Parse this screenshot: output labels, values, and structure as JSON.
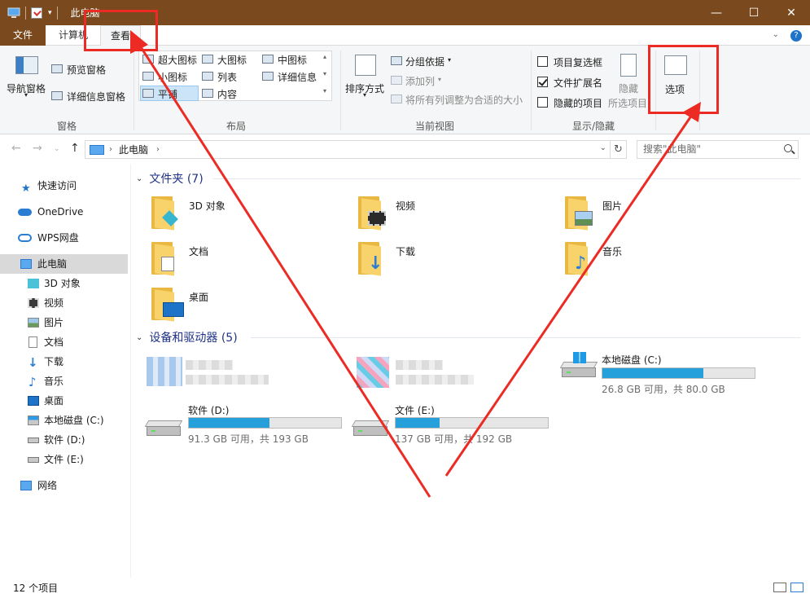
{
  "titlebar": {
    "title": "此电脑",
    "minimize_glyph": "—",
    "maximize_glyph": "☐",
    "close_glyph": "✕"
  },
  "tabs": {
    "file": "文件",
    "computer": "计算机",
    "view": "查看"
  },
  "ribbon": {
    "pane": {
      "nav_pane": "导航窗格",
      "preview_pane": "预览窗格",
      "details_pane": "详细信息窗格",
      "label": "窗格"
    },
    "layout": {
      "xl_icons": "超大图标",
      "large_icons": "大图标",
      "medium_icons": "中图标",
      "small_icons": "小图标",
      "list": "列表",
      "details": "详细信息",
      "tiles": "平铺",
      "content": "内容",
      "label": "布局"
    },
    "current_view": {
      "sort_by": "排序方式",
      "group_by": "分组依据",
      "add_column": "添加列",
      "fit_columns": "将所有列调整为合适的大小",
      "label": "当前视图"
    },
    "show_hide": {
      "item_checkboxes": "项目复选框",
      "file_extensions": "文件扩展名",
      "hidden_items": "隐藏的项目",
      "hide_selected": "隐藏",
      "hide_selected_sub": "所选项目",
      "label": "显示/隐藏",
      "checks": {
        "item_checkboxes": false,
        "file_extensions": true,
        "hidden_items": false
      }
    },
    "options": "选项"
  },
  "address": {
    "path": "此电脑",
    "search_placeholder": "搜索\"此电脑\""
  },
  "sidebar": {
    "items": [
      {
        "label": "快速访问"
      },
      {
        "label": "OneDrive"
      },
      {
        "label": "WPS网盘"
      },
      {
        "label": "此电脑"
      },
      {
        "label": "3D 对象"
      },
      {
        "label": "视频"
      },
      {
        "label": "图片"
      },
      {
        "label": "文档"
      },
      {
        "label": "下载"
      },
      {
        "label": "音乐"
      },
      {
        "label": "桌面"
      },
      {
        "label": "本地磁盘 (C:)"
      },
      {
        "label": "软件 (D:)"
      },
      {
        "label": "文件 (E:)"
      },
      {
        "label": "网络"
      }
    ]
  },
  "folders": {
    "header": "文件夹 (7)",
    "items": [
      "3D 对象",
      "视频",
      "图片",
      "文档",
      "下载",
      "音乐",
      "桌面"
    ]
  },
  "devices": {
    "header": "设备和驱动器 (5)",
    "drives": [
      {
        "name": "本地磁盘 (C:)",
        "free": "26.8 GB 可用，共 80.0 GB",
        "used_fraction": 0.665
      },
      {
        "name": "软件 (D:)",
        "free": "91.3 GB 可用，共 193 GB",
        "used_fraction": 0.527
      },
      {
        "name": "文件 (E:)",
        "free": "137 GB 可用，共 192 GB",
        "used_fraction": 0.287
      }
    ]
  },
  "status": {
    "count": "12 个项目"
  },
  "colors": {
    "titlebar": "#7a4a1e",
    "accent": "#26a0da",
    "annotation": "#ec2b24"
  }
}
